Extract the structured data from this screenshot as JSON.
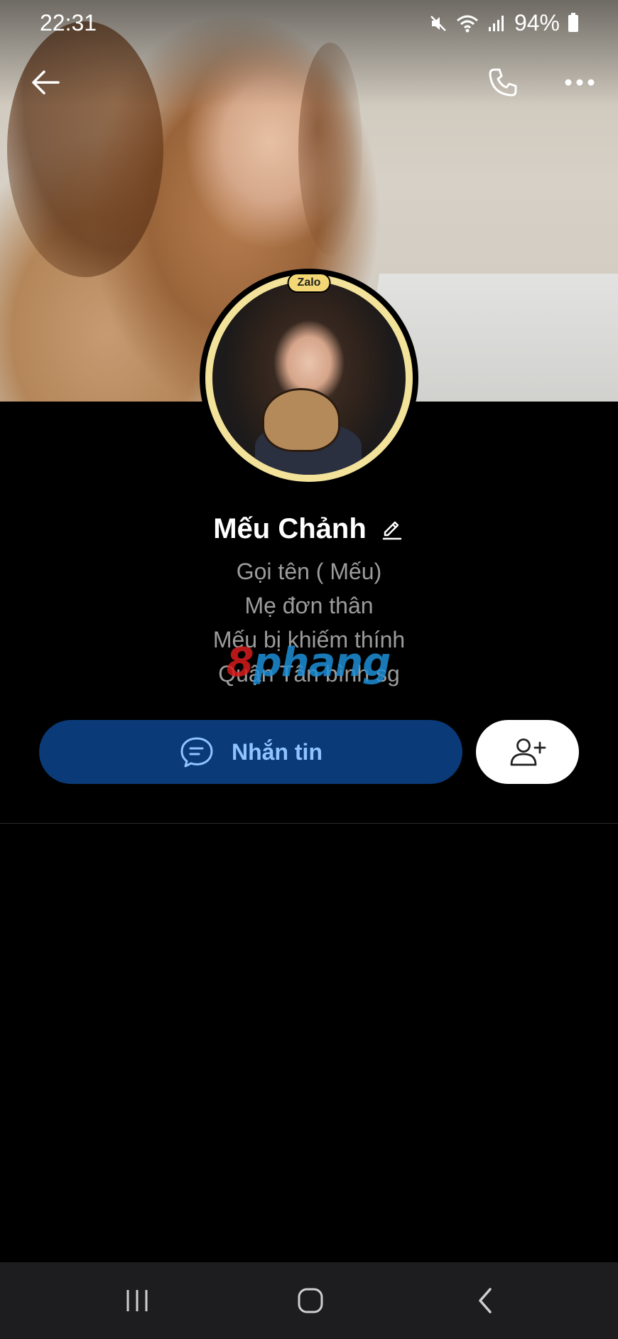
{
  "status_bar": {
    "time": "22:31",
    "battery": "94%",
    "icons": [
      "mute-icon",
      "wifi-icon",
      "signal-icon",
      "battery-icon"
    ]
  },
  "header": {
    "back_icon": "back-arrow-icon",
    "call_icon": "phone-icon",
    "more_icon": "more-dots-icon"
  },
  "avatar": {
    "badge": "Zalo"
  },
  "profile": {
    "name": "Mếu Chảnh",
    "edit_icon": "pencil-icon",
    "bio": [
      "Gọi tên ( Mếu)",
      "Mẹ đơn thân",
      "Mếu bị khiếm thính",
      "Quận Tân bình sg"
    ]
  },
  "watermark": {
    "part1": "8",
    "part2": "phang"
  },
  "actions": {
    "message_label": "Nhắn tin",
    "message_icon": "chat-bubble-icon",
    "add_friend_icon": "add-friend-icon"
  },
  "colors": {
    "background": "#000000",
    "message_button": "#0a3a78",
    "message_text": "#8fc4ff",
    "bio_text": "#9c9c9c",
    "avatar_ring": "#f3e29a"
  }
}
